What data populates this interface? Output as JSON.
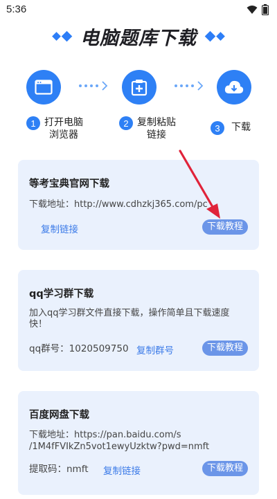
{
  "status": {
    "time": "5:36"
  },
  "title": "电脑题库下载",
  "steps": [
    {
      "number": "1",
      "label_line1": "打开电脑",
      "label_line2": "浏览器",
      "icon": "browser-window-icon"
    },
    {
      "number": "2",
      "label_line1": "复制粘贴",
      "label_line2": "链接",
      "icon": "paste-link-icon"
    },
    {
      "number": "3",
      "label_line1": "下载",
      "label_line2": "",
      "icon": "cloud-download-icon"
    }
  ],
  "cards": [
    {
      "title": "等考宝典官网下载",
      "line1": "下载地址：http://www.cdhzkj365.com/pc",
      "link_label": "复制链接",
      "tutorial_label": "下载教程"
    },
    {
      "title": "qq学习群下载",
      "line1": "加入qq学习群文件直接下载，操作简单且下载速度",
      "line2": "快！",
      "group_label": "qq群号：1020509750",
      "link_label": "复制群号",
      "tutorial_label": "下载教程"
    },
    {
      "title": "百度网盘下载",
      "line1": "下载地址：https://pan.baidu.com/s",
      "line2": "/1M4fFVIkZn5vot1ewyUzktw?pwd=nmft",
      "code_label": "提取码：nmft",
      "link_label": "复制链接",
      "tutorial_label": "下载教程"
    }
  ],
  "colors": {
    "accent": "#2e80f5",
    "card_bg": "#eaf1fd",
    "pill": "#6b95e8",
    "link": "#3c7be8",
    "arrow": "#e0233a"
  }
}
